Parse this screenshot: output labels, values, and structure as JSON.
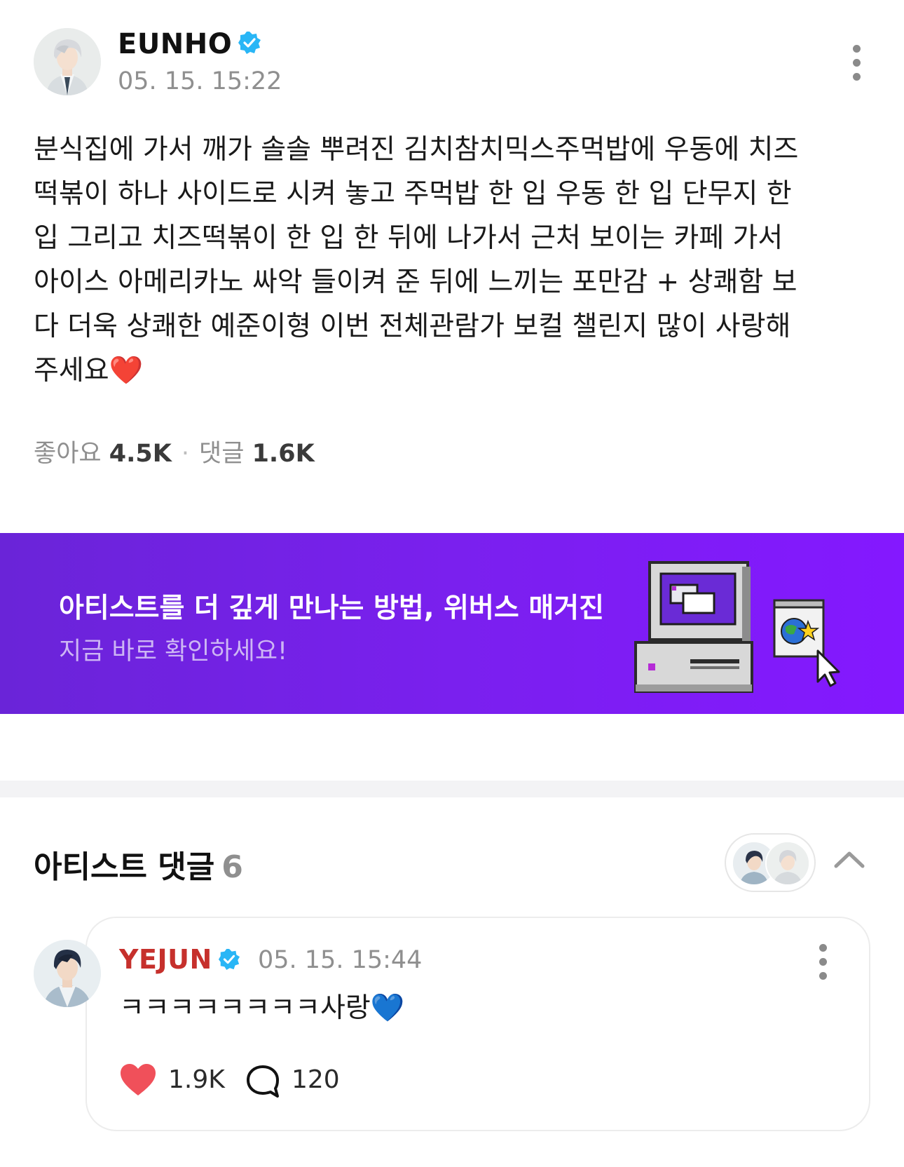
{
  "post": {
    "author": "EUNHO",
    "timestamp": "05. 15. 15:22",
    "body": "분식집에 가서 깨가 솔솔 뿌려진 김치참치믹스주먹밥에 우동에 치즈\n떡볶이 하나 사이드로 시켜 놓고 주먹밥 한 입 우동 한 입 단무지 한\n입 그리고 치즈떡볶이 한 입 한 뒤에 나가서 근처 보이는 카페 가서\n아이스 아메리카노 싸악 들이켜 준 뒤에 느끼는 포만감 + 상쾌함 보\n다 더욱 상쾌한 예준이형 이번 전체관람가 보컬 챌린지 많이 사랑해\n주세요",
    "body_emoji": "❤️",
    "likes_label": "좋아요",
    "likes_count": "4.5K",
    "comments_label": "댓글",
    "comments_count": "1.6K"
  },
  "banner": {
    "title": "아티스트를 더 깊게 만나는 방법, 위버스 매거진",
    "subtitle": "지금 바로 확인하세요!"
  },
  "artist_comments": {
    "title": "아티스트 댓글",
    "count": "6",
    "items": [
      {
        "author": "YEJUN",
        "timestamp": "05. 15. 15:44",
        "text": "ㅋㅋㅋㅋㅋㅋㅋㅋ사랑",
        "emoji": "💙",
        "likes": "1.9K",
        "replies": "120"
      }
    ]
  },
  "colors": {
    "verified": "#29b6f6",
    "banner_start": "#6a24d8",
    "banner_end": "#8418ff",
    "comment_author": "#c6302c",
    "like_heart": "#f0505a"
  },
  "icons": [
    "verified-badge-icon",
    "more-vertical-icon",
    "computer-icon",
    "globe-star-icon",
    "cursor-icon",
    "chevron-up-icon",
    "heart-icon",
    "comment-bubble-icon"
  ]
}
